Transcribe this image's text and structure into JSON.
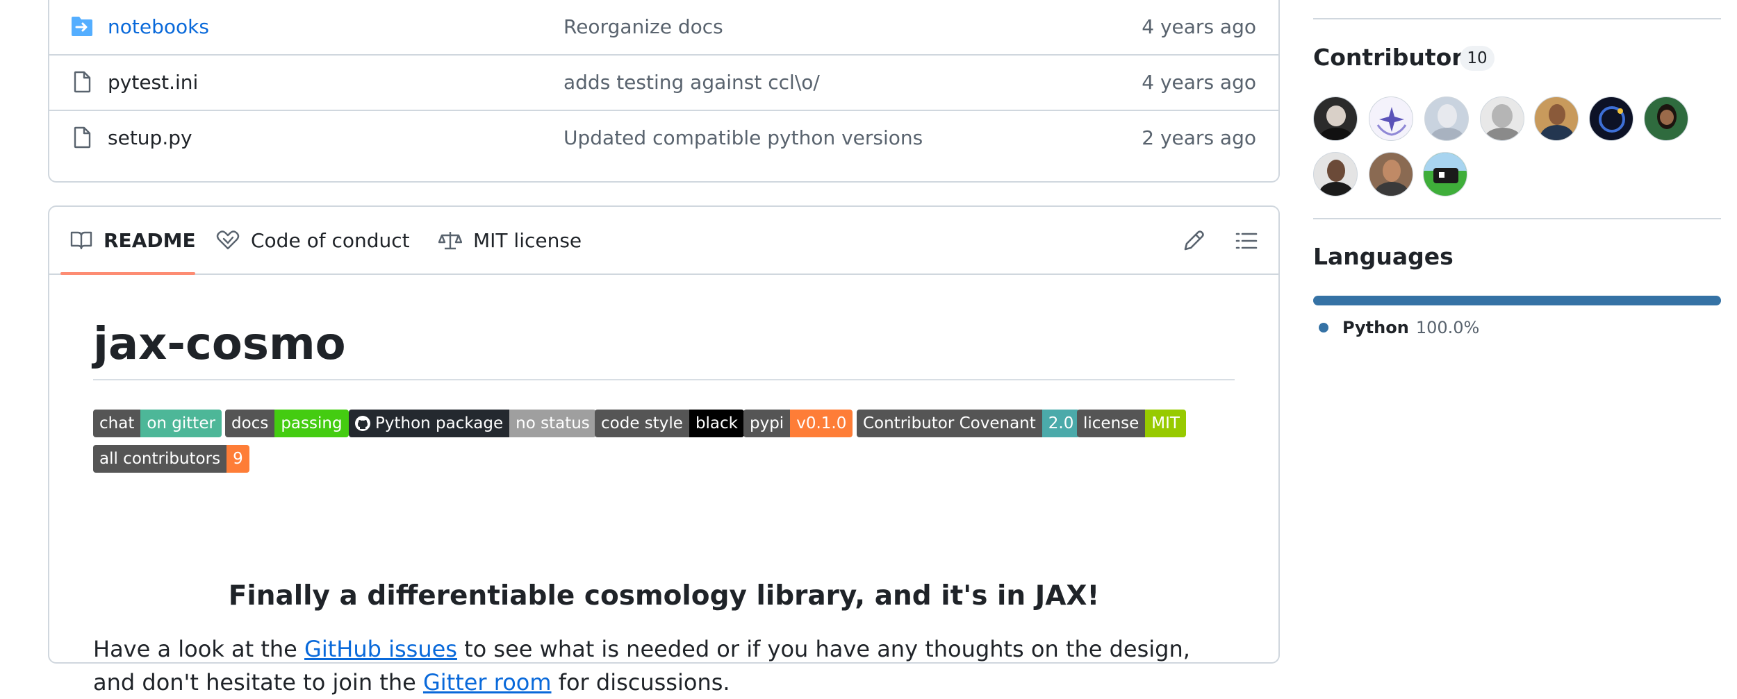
{
  "files": [
    {
      "name": "notebooks",
      "type": "folder",
      "message": "Reorganize docs",
      "age": "4 years ago"
    },
    {
      "name": "pytest.ini",
      "type": "file",
      "message": "adds testing against ccl\\o/",
      "age": "4 years ago"
    },
    {
      "name": "setup.py",
      "type": "file",
      "message": "Updated compatible python versions",
      "age": "2 years ago"
    }
  ],
  "readme_tabs": {
    "readme": "README",
    "conduct": "Code of conduct",
    "license": "MIT license"
  },
  "readme": {
    "title": "jax-cosmo",
    "badges": [
      {
        "left": "chat",
        "right": "on gitter",
        "color": "#4db798"
      },
      {
        "left": "docs",
        "right": "passing",
        "color": "#4c1"
      },
      {
        "left": "Python package",
        "right": "no status",
        "color": "#9f9f9f",
        "icon": "github-icon",
        "left_color": "#24292f"
      },
      {
        "left": "code style",
        "right": "black",
        "color": "#000000"
      },
      {
        "left": "pypi",
        "right": "v0.1.0",
        "color": "#fe7d37"
      },
      {
        "left": "Contributor Covenant",
        "right": "2.0",
        "color": "#4baaaa"
      },
      {
        "left": "license",
        "right": "MIT",
        "color": "#97ca00"
      },
      {
        "left": "all contributors",
        "right": "9",
        "color": "#fe7d37"
      }
    ],
    "tagline": "Finally a differentiable cosmology library, and it's in JAX!",
    "para_1": "Have a look at the ",
    "link_issues": "GitHub issues",
    "para_2": " to see what is needed or if you have any thoughts on the design, and don't hesitate to join the ",
    "link_gitter": "Gitter room",
    "para_3": " for discussions."
  },
  "sidebar": {
    "contributors_heading": "Contributors",
    "contributors_count": "10",
    "languages_heading": "Languages",
    "languages": [
      {
        "name": "Python",
        "percent": "100.0%",
        "color": "#3572A5"
      }
    ]
  },
  "colors": {
    "accent": "#0969da",
    "tab_underline": "#fd8c73"
  }
}
